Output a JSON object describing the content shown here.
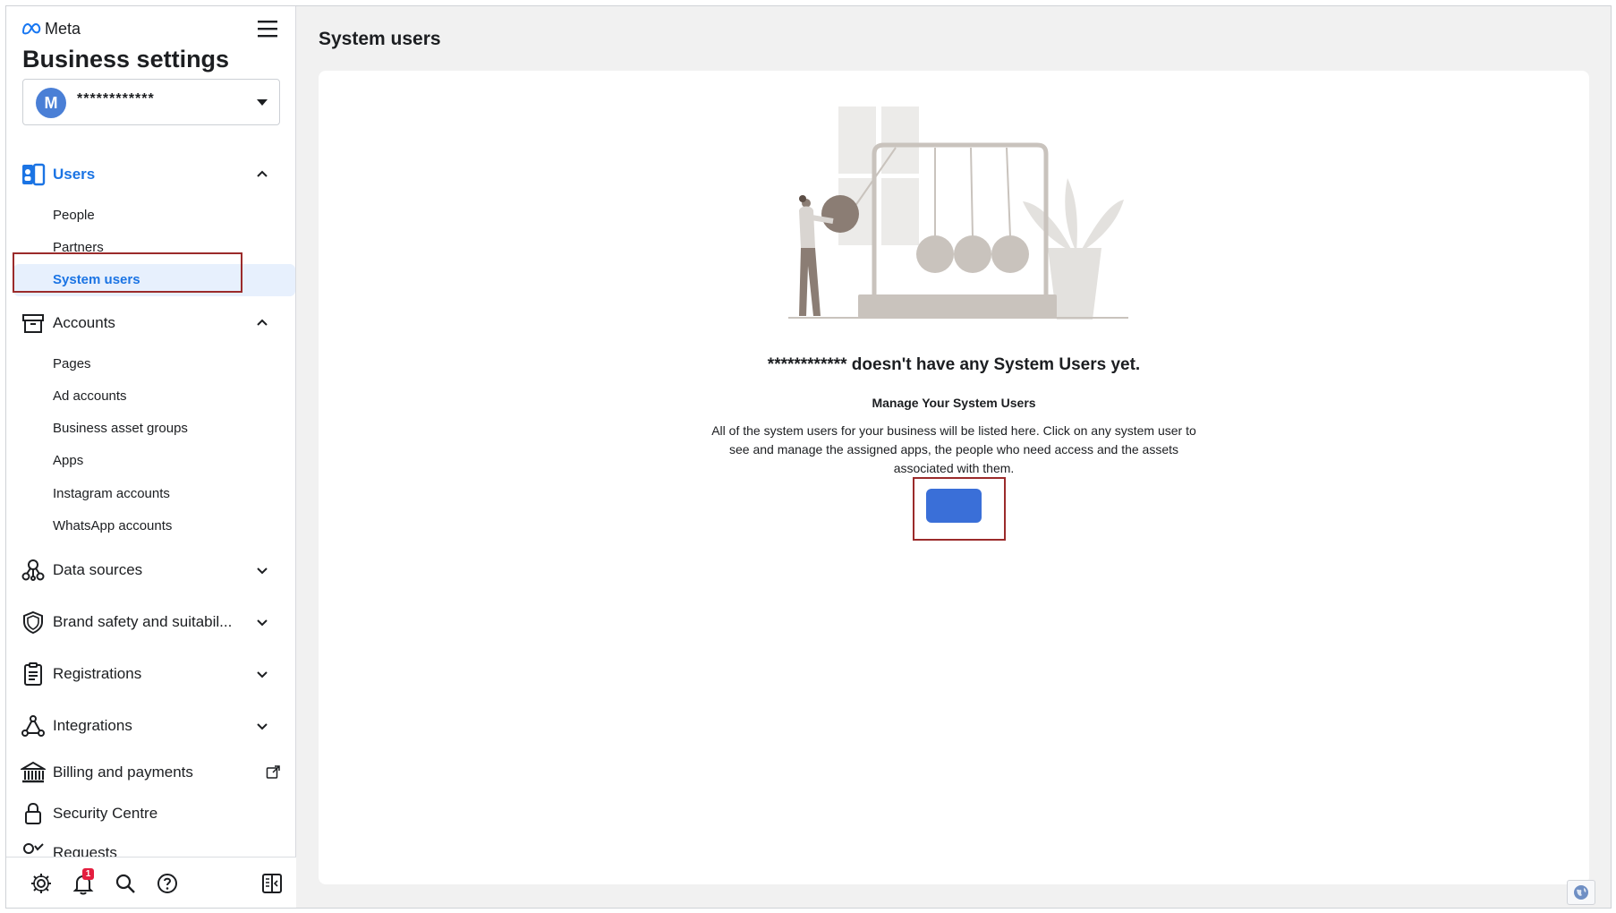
{
  "sidebar": {
    "brand": "Meta",
    "heading": "Business settings",
    "account": {
      "avatar_letter": "M",
      "name": "************"
    },
    "sections": {
      "users": {
        "label": "Users",
        "items": [
          "People",
          "Partners",
          "System users"
        ]
      },
      "accounts": {
        "label": "Accounts",
        "items": [
          "Pages",
          "Ad accounts",
          "Business asset groups",
          "Apps",
          "Instagram accounts",
          "WhatsApp accounts"
        ]
      },
      "data_sources": {
        "label": "Data sources"
      },
      "brand_safety": {
        "label": "Brand safety and suitabil..."
      },
      "registrations": {
        "label": "Registrations"
      },
      "integrations": {
        "label": "Integrations"
      },
      "billing": {
        "label": "Billing and payments"
      },
      "security": {
        "label": "Security Centre"
      },
      "requests": {
        "label": "Requests"
      }
    },
    "footer": {
      "notification_count": "1"
    }
  },
  "main": {
    "title": "System users",
    "empty_state": {
      "title": "************ doesn't have any System Users yet.",
      "subtitle": "Manage Your System Users",
      "description": "All of the system users for your business will be listed here. Click on any system user to see and manage the assigned apps, the people who need access and the assets associated with them."
    }
  },
  "colors": {
    "accent": "#1b74e4",
    "button": "#3a6fd8",
    "highlight": "#9b2b2b"
  },
  "icons": [
    "meta-logo-icon",
    "hamburger-menu-icon",
    "users-icon",
    "accounts-icon",
    "data-sources-icon",
    "shield-icon",
    "clipboard-icon",
    "integrations-icon",
    "bank-icon",
    "external-link-icon",
    "lock-icon",
    "key-icon",
    "gear-icon",
    "bell-icon",
    "search-icon",
    "help-icon",
    "panel-toggle-icon",
    "globe-icon"
  ]
}
